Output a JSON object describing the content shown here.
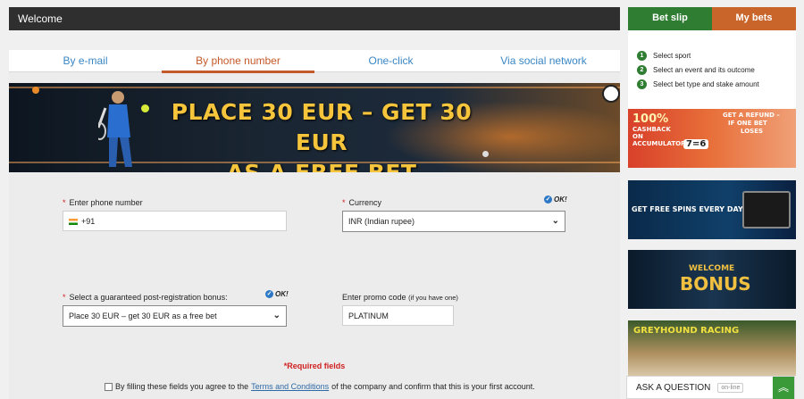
{
  "header": {
    "title": "Welcome"
  },
  "tabs": [
    {
      "label": "By e-mail"
    },
    {
      "label": "By phone number"
    },
    {
      "label": "One-click"
    },
    {
      "label": "Via social network"
    }
  ],
  "banner": {
    "line1": "PLACE 30 EUR – GET 30 EUR",
    "line2": "AS A FREE BET"
  },
  "form": {
    "phone": {
      "label": "Enter phone number",
      "value": "+91"
    },
    "currency": {
      "label": "Currency",
      "value": "INR (Indian rupee)",
      "ok": "OK!"
    },
    "bonus": {
      "label": "Select a guaranteed post-registration bonus:",
      "value": "Place 30 EUR – get 30 EUR as a free bet",
      "ok": "OK!"
    },
    "promo": {
      "label": "Enter promo code",
      "hint": "(if you have one)",
      "value": "PLATINUM"
    },
    "required_note": "*Required fields",
    "agree_prefix": "By filling these fields you agree to the",
    "agree_link": "Terms and Conditions",
    "agree_suffix": "of the company and confirm that this is your first account."
  },
  "betslip": {
    "tab_betslip": "Bet slip",
    "tab_mybets": "My bets",
    "steps": [
      {
        "num": "1",
        "text": "Select sport"
      },
      {
        "num": "2",
        "text": "Select an event and its outcome"
      },
      {
        "num": "3",
        "text": "Select bet type and stake amount"
      }
    ]
  },
  "promos": {
    "cashback": {
      "big": "100%",
      "sub1": "CASHBACK",
      "sub2": "ON",
      "sub3": "ACCUMULATORS",
      "score": "7=6",
      "right1": "GET A REFUND –",
      "right2": "IF ONE BET",
      "right3": "LOSES"
    },
    "spins": {
      "text": "GET FREE SPINS EVERY DAY"
    },
    "welcome": {
      "line1": "WELCOME",
      "line2": "BONUS"
    },
    "greyhound": {
      "text": "GREYHOUND RACING"
    }
  },
  "chat": {
    "label": "ASK A QUESTION",
    "status": "on-line"
  },
  "colors": {
    "accent": "#c45a2a",
    "link": "#3a86c4",
    "betslip_green": "#2e7d32",
    "mybets_orange": "#c9642a",
    "banner_yellow": "#f7c53b"
  }
}
